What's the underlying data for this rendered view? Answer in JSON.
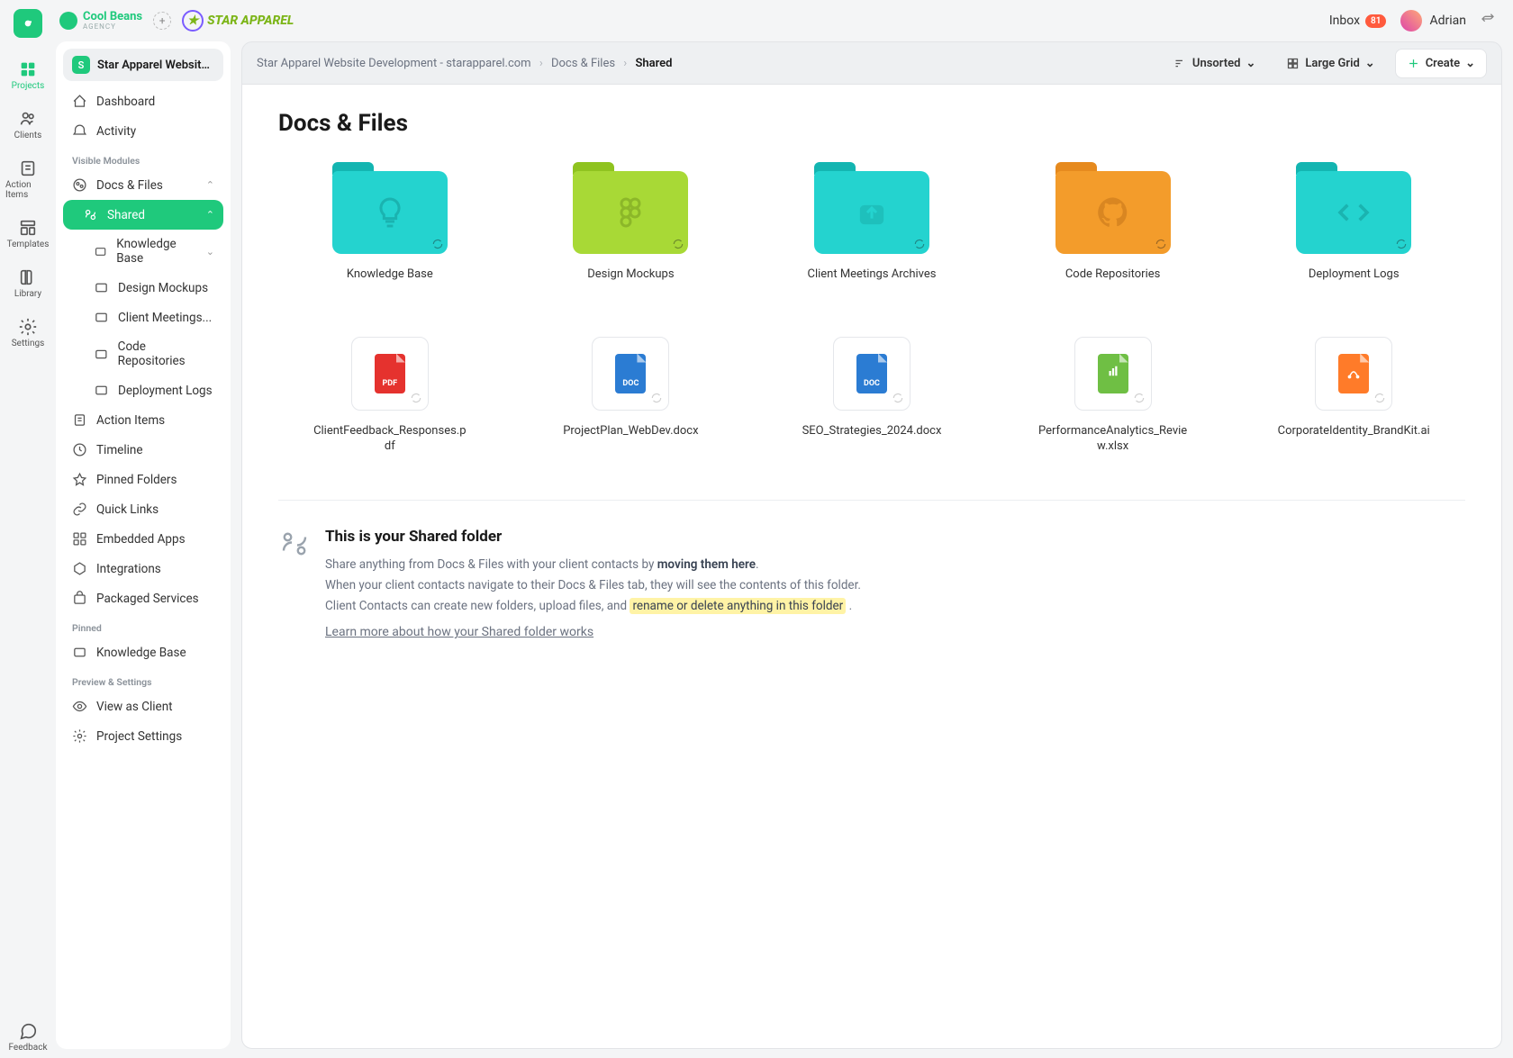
{
  "rail": {
    "items": [
      {
        "label": "Projects"
      },
      {
        "label": "Clients"
      },
      {
        "label": "Action Items"
      },
      {
        "label": "Templates"
      },
      {
        "label": "Library"
      },
      {
        "label": "Settings"
      }
    ],
    "feedback": "Feedback"
  },
  "topbar": {
    "agency_name": "Cool Beans",
    "agency_sub": "AGENCY",
    "client_brand": "STAR APPAREL",
    "inbox_label": "Inbox",
    "inbox_count": "81",
    "user_name": "Adrian"
  },
  "sidebar": {
    "project_title": "Star Apparel Website Dev...",
    "project_initial": "S",
    "dashboard": "Dashboard",
    "activity": "Activity",
    "section_visible": "Visible Modules",
    "docs_files": "Docs & Files",
    "shared": "Shared",
    "tree": {
      "knowledge_base": "Knowledge Base",
      "design_mockups": "Design Mockups",
      "client_meetings": "Client Meetings...",
      "code_repos": "Code Repositories",
      "deployment_logs": "Deployment Logs"
    },
    "action_items": "Action Items",
    "timeline": "Timeline",
    "pinned_folders": "Pinned Folders",
    "quick_links": "Quick Links",
    "embedded_apps": "Embedded Apps",
    "integrations": "Integrations",
    "packaged_services": "Packaged Services",
    "section_pinned": "Pinned",
    "pinned_kb": "Knowledge Base",
    "section_preview": "Preview & Settings",
    "view_as_client": "View as Client",
    "project_settings": "Project Settings"
  },
  "main_header": {
    "breadcrumb_root": "Star Apparel Website Development - starapparel.com",
    "breadcrumb_mid": "Docs & Files",
    "breadcrumb_current": "Shared",
    "sort_label": "Unsorted",
    "view_label": "Large Grid",
    "create_label": "Create"
  },
  "content": {
    "page_title": "Docs & Files",
    "folders": [
      {
        "name": "Knowledge Base",
        "color": "teal",
        "icon": "bulb"
      },
      {
        "name": "Design Mockups",
        "color": "lime",
        "icon": "figma"
      },
      {
        "name": "Client Meetings Archives",
        "color": "teal",
        "icon": "upload"
      },
      {
        "name": "Code Repositories",
        "color": "orange",
        "icon": "github"
      },
      {
        "name": "Deployment Logs",
        "color": "teal",
        "icon": "code"
      }
    ],
    "files": [
      {
        "name": "ClientFeedback_Responses.pdf",
        "type": "pdf",
        "label": "PDF"
      },
      {
        "name": "ProjectPlan_WebDev.docx",
        "type": "doc",
        "label": "DOC"
      },
      {
        "name": "SEO_Strategies_2024.docx",
        "type": "doc",
        "label": "DOC"
      },
      {
        "name": "PerformanceAnalytics_Review.xlsx",
        "type": "xls",
        "label": ""
      },
      {
        "name": "CorporateIdentity_BrandKit.ai",
        "type": "ai",
        "label": ""
      }
    ],
    "info": {
      "title": "This is your Shared folder",
      "line1_a": "Share anything from Docs & Files with your client contacts by ",
      "line1_b": "moving them here",
      "line1_c": ".",
      "line2": "When your client contacts navigate to their Docs & Files tab, they will see the contents of this folder.",
      "line3_a": "Client Contacts can create new folders, upload files, and ",
      "line3_b": "rename or delete anything in this folder",
      "line3_c": " .",
      "link": "Learn more about how your Shared folder works"
    }
  }
}
